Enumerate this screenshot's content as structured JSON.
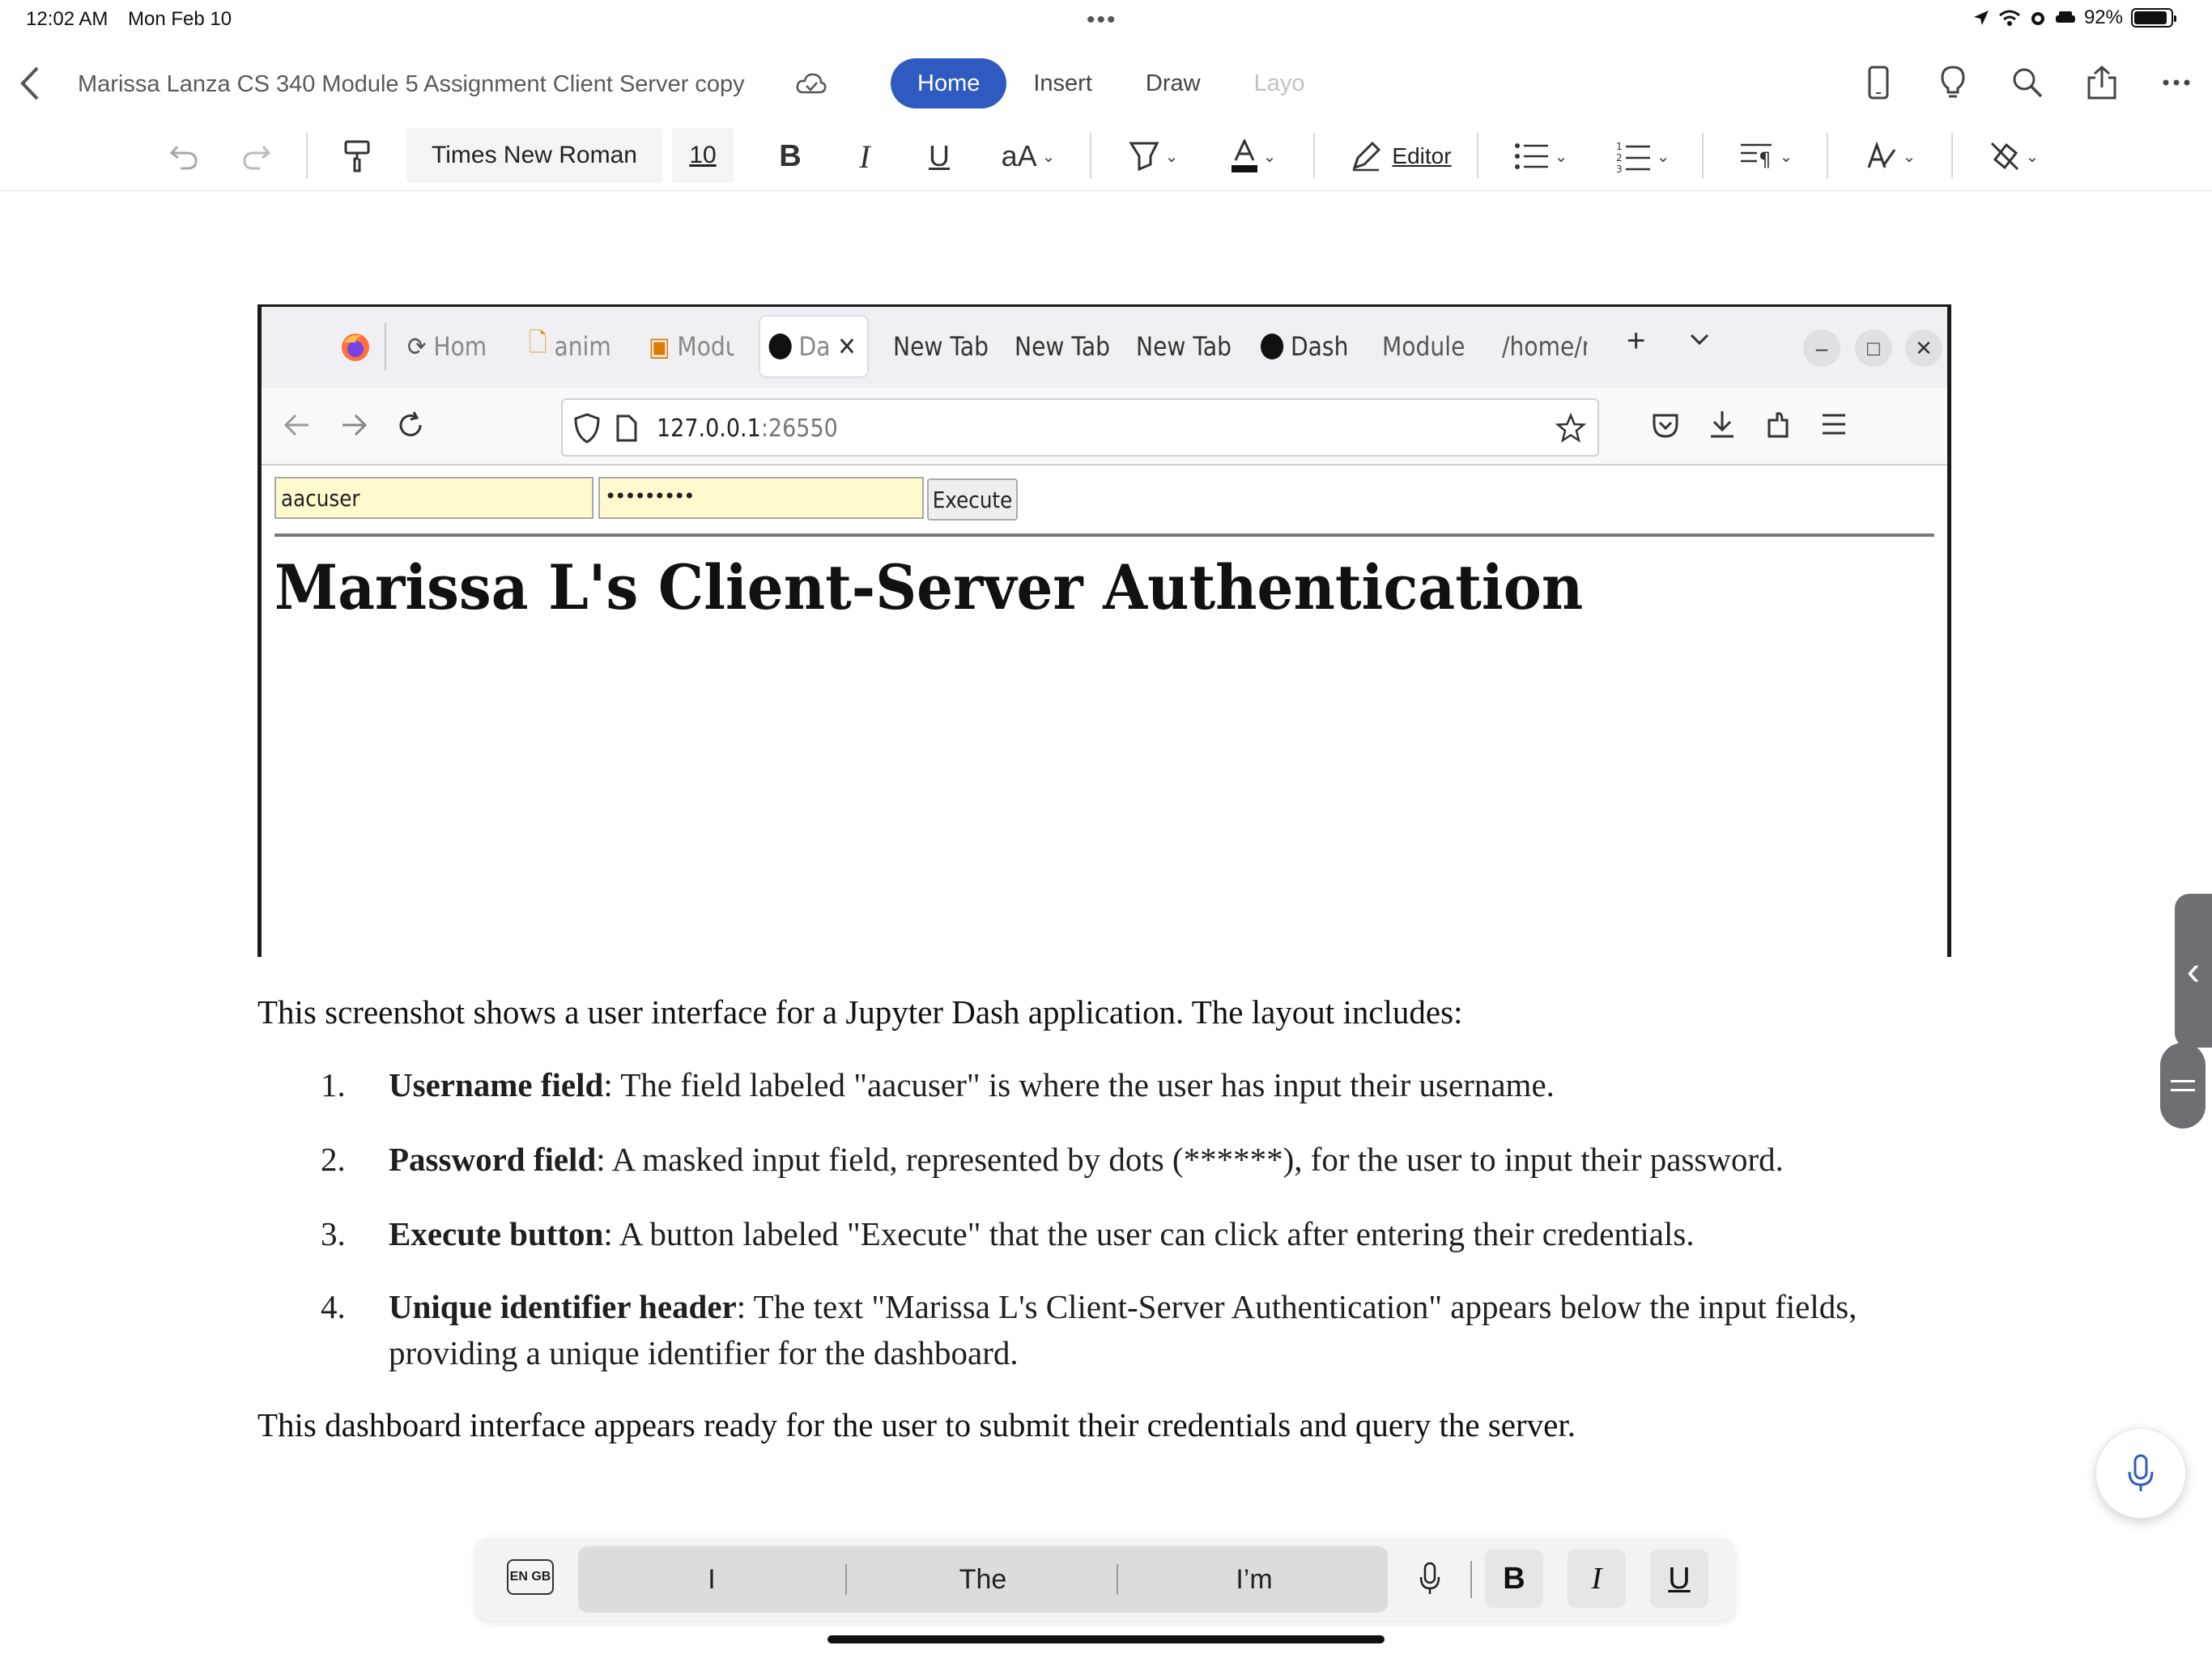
{
  "status_bar": {
    "time": "12:02 AM",
    "date": "Mon Feb 10",
    "battery": "92%",
    "battery_level": 0.92
  },
  "word": {
    "doc_title": "Marissa Lanza CS 340 Module 5 Assignment Client Server copy",
    "tabs": [
      {
        "label": "Home",
        "active": true
      },
      {
        "label": "Insert"
      },
      {
        "label": "Draw"
      },
      {
        "label": "Layo"
      }
    ],
    "toolbar": {
      "font_name": "Times New Roman",
      "font_size": "10",
      "bold": "B",
      "italic": "I",
      "underline": "U",
      "text_size": "aA",
      "editor": "Editor"
    }
  },
  "browser": {
    "tabs": [
      "Home",
      "anim",
      "Modu",
      "Da",
      "New Tab",
      "New Tab",
      "New Tab",
      "Dash",
      "Module",
      "/home/n"
    ],
    "url_host": "127.0.0.1",
    "url_port": ":26550",
    "app": {
      "username_value": "aacuser",
      "password_value": "•••••••••",
      "execute_label": "Execute",
      "header": "Marissa L's Client-Server Authentication"
    }
  },
  "document": {
    "intro": "This screenshot shows a user interface for a Jupyter Dash application. The layout includes:",
    "items": [
      {
        "num": "1.",
        "term": "Username field",
        "text": ": The field labeled \"aacuser\" is where the user has input their username."
      },
      {
        "num": "2.",
        "term": "Password field",
        "text": ": A masked input field, represented by dots (******), for the user to input their password."
      },
      {
        "num": "3.",
        "term": "Execute button",
        "text": ": A button labeled \"Execute\" that the user can click after entering their credentials."
      },
      {
        "num": "4.",
        "term": "Unique identifier header",
        "text": ": The text \"Marissa L's Client-Server Authentication\" appears below the input fields, providing a unique identifier for the dashboard."
      }
    ],
    "outro": "This dashboard interface appears ready for the user to submit their credentials and query the server."
  },
  "keyboard_bar": {
    "lang": "EN GB",
    "suggestions": [
      "I",
      "The",
      "I’m"
    ],
    "bold": "B",
    "italic": "I",
    "underline": "U"
  },
  "colors": {
    "accent": "#2f5bc1",
    "dash_input_bg": "#fffacd",
    "side_handle": "#6e6e73"
  }
}
